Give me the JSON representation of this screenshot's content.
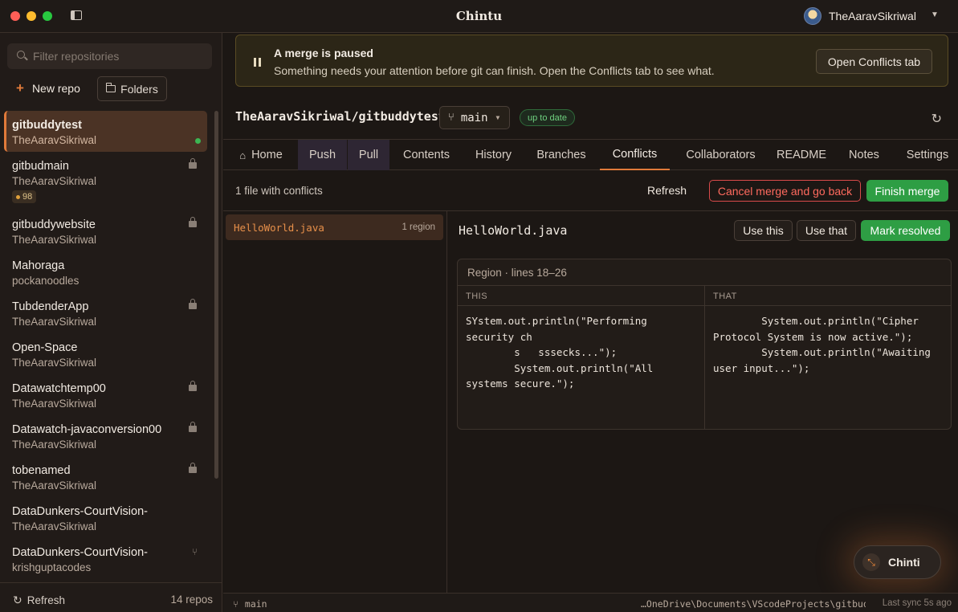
{
  "window": {
    "title": "Chintu",
    "user": "TheAaravSikriwal"
  },
  "sidebar": {
    "filter_placeholder": "Filter repositories",
    "new_repo_label": "New repo",
    "folders_label": "Folders",
    "repos": [
      {
        "name": "gitbuddytest",
        "owner": "TheAaravSikriwal",
        "active": true,
        "private": false,
        "status": "synced"
      },
      {
        "name": "gitbudmain",
        "owner": "TheAaravSikriwal",
        "private": true,
        "badge": "98"
      },
      {
        "name": "gitbuddywebsite",
        "owner": "TheAaravSikriwal",
        "private": true
      },
      {
        "name": "Mahoraga",
        "owner": "pockanoodles",
        "private": false
      },
      {
        "name": "TubdenderApp",
        "owner": "TheAaravSikriwal",
        "private": true
      },
      {
        "name": "Open-Space",
        "owner": "TheAaravSikriwal",
        "private": false
      },
      {
        "name": "Datawatchtemp00",
        "owner": "TheAaravSikriwal",
        "private": true
      },
      {
        "name": "Datawatch-javaconversion00",
        "owner": "TheAaravSikriwal",
        "private": true
      },
      {
        "name": "tobenamed",
        "owner": "TheAaravSikriwal",
        "private": true
      },
      {
        "name": "DataDunkers-CourtVision-",
        "owner": "TheAaravSikriwal",
        "private": false
      },
      {
        "name": "DataDunkers-CourtVision-",
        "owner": "krishguptacodes",
        "fork": true
      }
    ],
    "refresh_label": "Refresh",
    "repo_count": "14 repos"
  },
  "banner": {
    "title": "A merge is paused",
    "message": "Something needs your attention before git can finish. Open the Conflicts tab to see what.",
    "button": "Open Conflicts tab"
  },
  "repo": {
    "full_name": "TheAaravSikriwal/gitbuddytest",
    "branch": "main",
    "status": "up to date"
  },
  "tabs": [
    {
      "label": "Home",
      "icon": "home-icon"
    },
    {
      "label": "Push"
    },
    {
      "label": "Pull"
    },
    {
      "label": "Contents"
    },
    {
      "label": "History"
    },
    {
      "label": "Branches"
    },
    {
      "label": "Conflicts",
      "active": true
    },
    {
      "label": "Collaborators"
    },
    {
      "label": "README"
    },
    {
      "label": "Notes"
    },
    {
      "label": "Settings"
    }
  ],
  "conflicts": {
    "summary": "1 file with conflicts",
    "refresh_label": "Refresh",
    "cancel_label": "Cancel merge and go back",
    "finish_label": "Finish merge",
    "files": [
      {
        "name": "HelloWorld.java",
        "regions": "1 region"
      }
    ],
    "detail": {
      "file": "HelloWorld.java",
      "use_this_label": "Use this",
      "use_that_label": "Use that",
      "mark_resolved_label": "Mark resolved",
      "region_label": "Region · lines 18–26",
      "this_header": "THIS",
      "that_header": "THAT",
      "this_code": "SYstem.out.println(\"Performing\nsecurity ch\n        s   sssecks...\");\n        System.out.println(\"All\nsystems secure.\");",
      "that_code": "        System.out.println(\"Cipher\nProtocol System is now active.\");\n        System.out.println(\"Awaiting\nuser input...\");"
    }
  },
  "assistant": {
    "label": "Chinti"
  },
  "statusbar": {
    "branch": "main",
    "path": "…OneDrive\\Documents\\VScodeProjects\\gitbuddy…",
    "last_sync": "Last sync 5s ago"
  },
  "colors": {
    "accent": "#e07a3a",
    "success": "#2e9e44",
    "danger": "#d94a4a",
    "background": "#1c1714"
  }
}
